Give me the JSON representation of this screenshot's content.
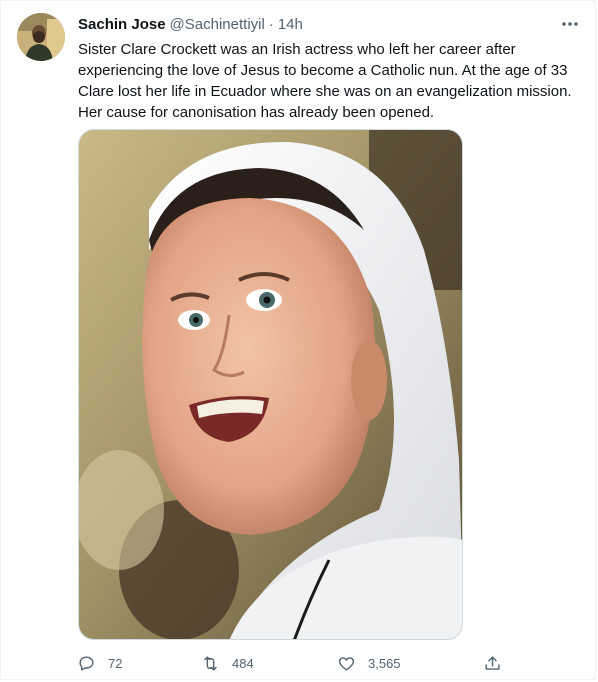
{
  "tweet": {
    "author_name": "Sachin Jose",
    "handle": "@Sachinettiyil",
    "separator": "·",
    "time": "14h",
    "text": "Sister Clare Crockett was an Irish actress who left her career after experiencing the love of Jesus to become a Catholic nun. At the age of 33 Clare lost her life in Ecuador where she was on an evangelization mission. Her cause for canonisation has already been opened."
  },
  "actions": {
    "reply_count": "72",
    "retweet_count": "484",
    "like_count": "3,565"
  },
  "icons": {
    "more": "more-horizontal-icon",
    "reply": "reply-icon",
    "retweet": "retweet-icon",
    "like": "heart-icon",
    "share": "share-icon"
  },
  "colors": {
    "text": "#0f1419",
    "secondary": "#536471",
    "border": "#cfd9de"
  }
}
